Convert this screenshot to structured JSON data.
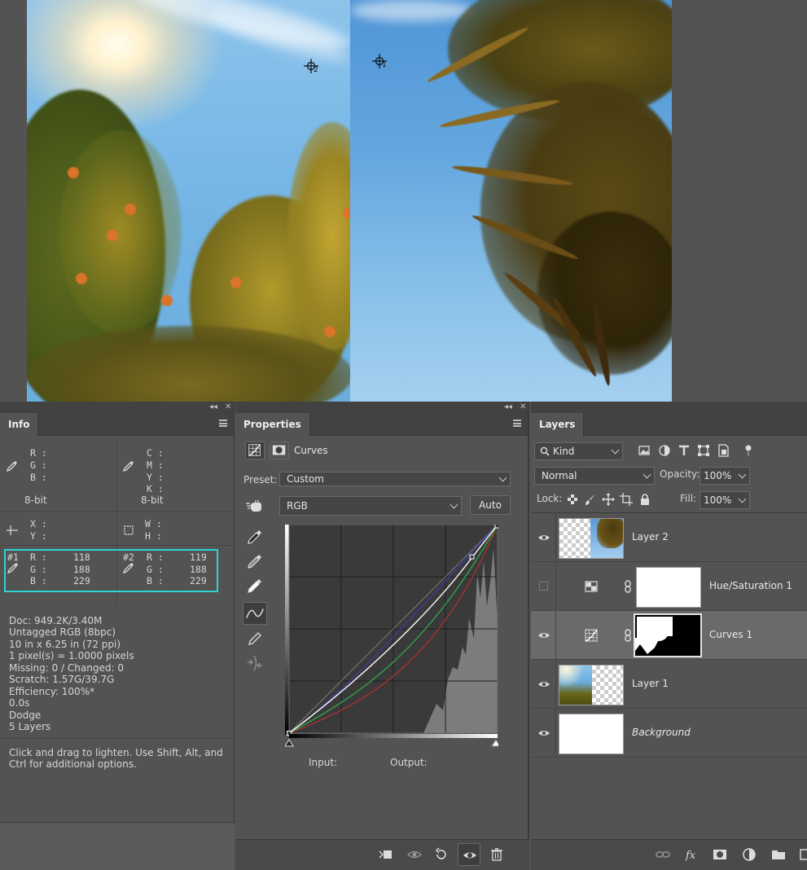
{
  "canvas": {
    "sampler_1_label": "1",
    "sampler_2_label": "2"
  },
  "info": {
    "tab_label": "Info",
    "rgb_labels": [
      "R :",
      "G :",
      "B :"
    ],
    "cmyk_labels": [
      "C :",
      "M :",
      "Y :",
      "K :"
    ],
    "bit_depth_left": "8-bit",
    "bit_depth_right": "8-bit",
    "xy_labels": [
      "X :",
      "Y :"
    ],
    "wh_labels": [
      "W :",
      "H :"
    ],
    "sample1": {
      "id": "#1",
      "r_label": "R :",
      "g_label": "G :",
      "b_label": "B :",
      "r": "118",
      "g": "188",
      "b": "229"
    },
    "sample2": {
      "id": "#2",
      "r_label": "R :",
      "g_label": "G :",
      "b_label": "B :",
      "r": "119",
      "g": "188",
      "b": "229"
    },
    "doc_lines": [
      "Doc: 949.2K/3.40M",
      "Untagged RGB (8bpc)",
      "10 in x 6.25 in (72 ppi)",
      "1 pixel(s) = 1.0000 pixels",
      "Missing: 0 / Changed: 0",
      "Scratch: 1.57G/39.7G",
      "Efficiency: 100%*",
      "0.0s",
      "Dodge",
      "5 Layers"
    ],
    "help_text": "Click and drag to lighten.  Use Shift, Alt, and Ctrl for additional options."
  },
  "properties": {
    "tab_label": "Properties",
    "adjustment_title": "Curves",
    "preset_label": "Preset:",
    "preset_value": "Custom",
    "channel_value": "RGB",
    "auto_label": "Auto",
    "input_label": "Input:",
    "output_label": "Output:"
  },
  "layers": {
    "tab_label": "Layers",
    "kind_filter": "Kind",
    "blend_mode": "Normal",
    "opacity_label": "Opacity:",
    "opacity_value": "100%",
    "lock_label": "Lock:",
    "fill_label": "Fill:",
    "fill_value": "100%",
    "items": [
      {
        "name": "Layer 2",
        "visible": true
      },
      {
        "name": "Hue/Saturation 1",
        "visible": false
      },
      {
        "name": "Curves 1",
        "visible": true,
        "selected": true
      },
      {
        "name": "Layer 1",
        "visible": true
      },
      {
        "name": "Background",
        "visible": true,
        "italic": true
      }
    ]
  },
  "colors": {
    "sample_highlight": "#2ed3d3",
    "curve_composite": "#ffffff",
    "curve_red": "#b03030",
    "curve_green": "#2fa84a",
    "curve_blue": "#3a3aaa"
  }
}
